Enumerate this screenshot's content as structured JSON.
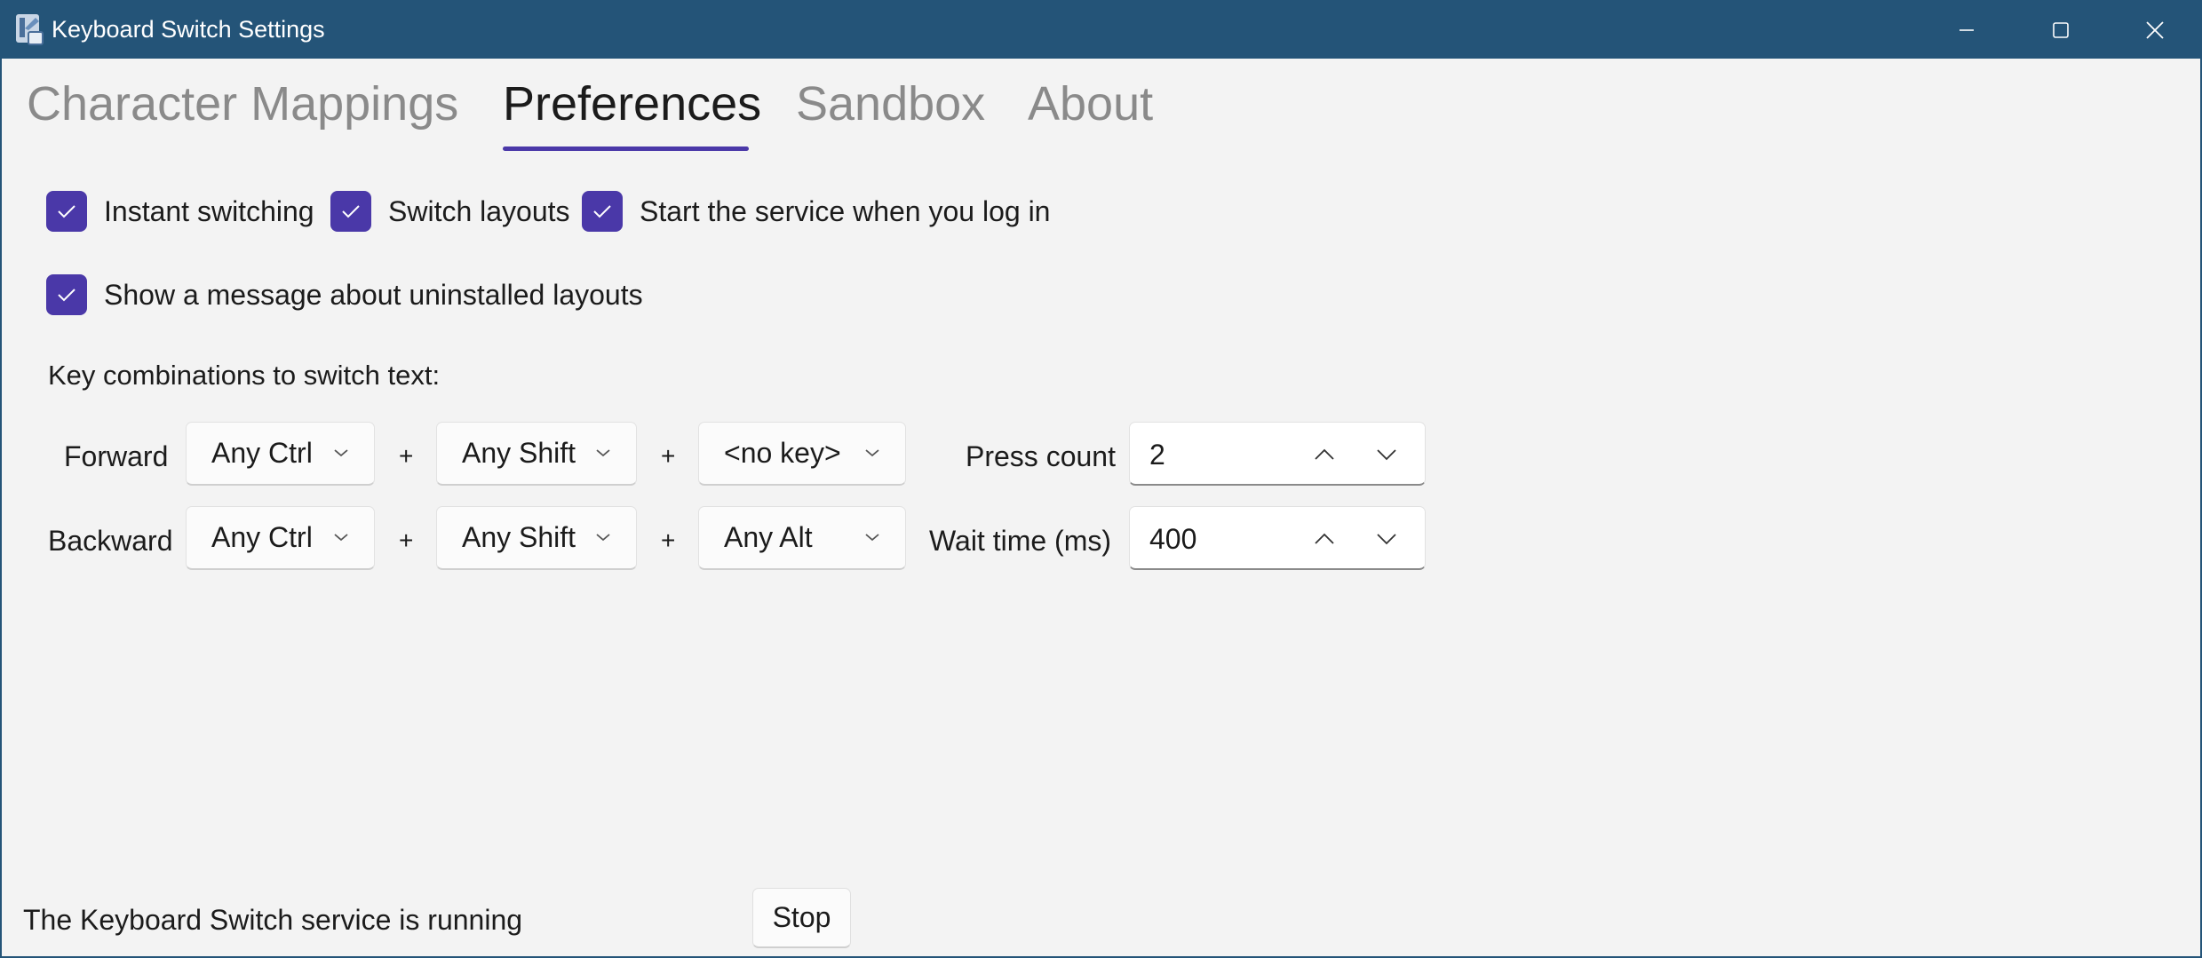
{
  "window": {
    "title": "Keyboard Switch Settings",
    "accent_color": "#245478"
  },
  "tabs": [
    {
      "label": "Character Mappings",
      "active": false
    },
    {
      "label": "Preferences",
      "active": true
    },
    {
      "label": "Sandbox",
      "active": false
    },
    {
      "label": "About",
      "active": false
    }
  ],
  "options": {
    "instant_switching": {
      "label": "Instant switching",
      "checked": true
    },
    "switch_layouts": {
      "label": "Switch layouts",
      "checked": true
    },
    "start_on_login": {
      "label": "Start the service when you log in",
      "checked": true
    },
    "uninstalled_message": {
      "label": "Show a message about uninstalled layouts",
      "checked": true
    }
  },
  "key_combinations": {
    "heading": "Key combinations to switch text:",
    "plus": "+",
    "forward": {
      "label": "Forward",
      "key1": "Any Ctrl",
      "key2": "Any Shift",
      "key3": "<no key>"
    },
    "backward": {
      "label": "Backward",
      "key1": "Any Ctrl",
      "key2": "Any Shift",
      "key3": "Any Alt"
    }
  },
  "press_count": {
    "label": "Press count",
    "value": "2"
  },
  "wait_time": {
    "label": "Wait time (ms)",
    "value": "400"
  },
  "checkbox_color": "#4a38a8",
  "status": {
    "text": "The Keyboard Switch service is running",
    "button_label": "Stop"
  }
}
